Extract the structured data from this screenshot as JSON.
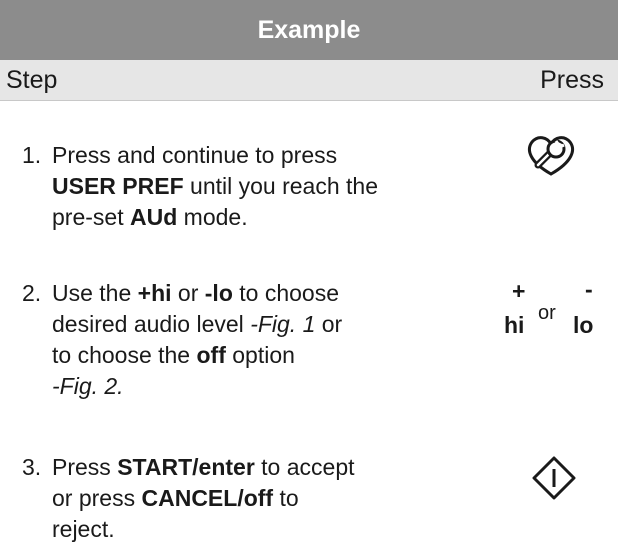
{
  "title": "Example",
  "header": {
    "step": "Step",
    "press": "Press"
  },
  "steps": [
    {
      "number": "1.",
      "line1": "Press and continue to press",
      "line2_bold": "USER PREF",
      "line2_rest": " until you reach the",
      "line3_pre": "pre-set ",
      "line3_bold": "AUd",
      "line3_rest": " mode.",
      "icon": "wrench-heart-icon"
    },
    {
      "number": "2.",
      "line1_pre": "Use the ",
      "line1_bold1": "+hi",
      "line1_mid": " or ",
      "line1_bold2": "-lo",
      "line1_rest": " to choose",
      "line2_pre": "desired audio level ",
      "line2_ital": "-Fig. 1",
      "line2_rest": " or",
      "line3_pre": "to choose the ",
      "line3_bold": "off",
      "line3_rest": " option",
      "line4_ital": "-Fig. 2.",
      "press": {
        "plus": "+",
        "minus": "-",
        "hi": "hi",
        "or": "or",
        "lo": "lo"
      }
    },
    {
      "number": "3.",
      "line1_pre": "Press ",
      "line1_bold": "START/enter",
      "line1_rest": " to accept",
      "line2_pre": "or press ",
      "line2_bold": "CANCEL/off",
      "line2_rest": " to",
      "line3": "reject.",
      "icon": "start-diamond-icon"
    }
  ]
}
